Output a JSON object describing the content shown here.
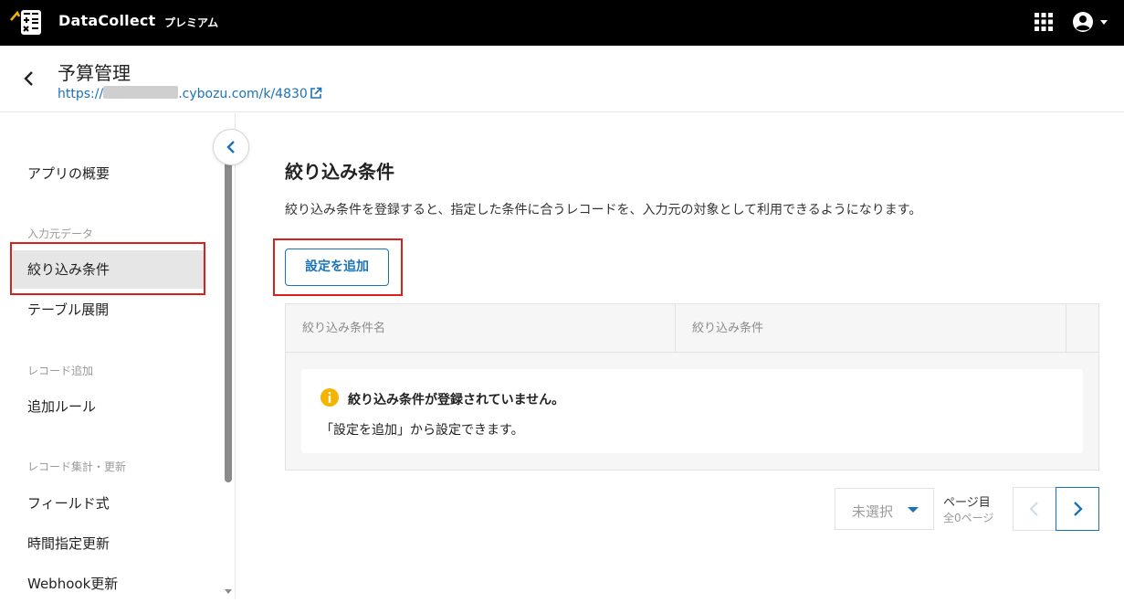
{
  "topbar": {
    "brand": "DataCollect",
    "plan": "プレミアム",
    "icons": [
      "datacollect-logo-icon",
      "apps-grid-icon",
      "account-icon",
      "caret-down-icon"
    ]
  },
  "app": {
    "title": "予算管理",
    "url_prefix": "https://",
    "url_suffix": ".cybozu.com/k/4830"
  },
  "sidebar": {
    "items": [
      {
        "label": "アプリの概要"
      },
      {
        "section": "入力元データ"
      },
      {
        "label": "絞り込み条件",
        "active": true
      },
      {
        "label": "テーブル展開"
      },
      {
        "section": "レコード追加"
      },
      {
        "label": "追加ルール"
      },
      {
        "section": "レコード集計・更新"
      },
      {
        "label": "フィールド式"
      },
      {
        "label": "時間指定更新"
      },
      {
        "label": "Webhook更新"
      }
    ]
  },
  "main": {
    "title": "絞り込み条件",
    "description": "絞り込み条件を登録すると、指定した条件に合うレコードを、入力元の対象として利用できるようになります。",
    "add_button": "設定を追加",
    "table": {
      "columns": [
        "絞り込み条件名",
        "絞り込み条件"
      ],
      "empty_title": "絞り込み条件が登録されていません。",
      "empty_desc": "「設定を追加」から設定できます。"
    },
    "pagination": {
      "select_value": "未選択",
      "page_label": "ページ目",
      "total": "全0ページ"
    }
  },
  "colors": {
    "accent": "#1a73b9",
    "highlight": "#d9211c",
    "warning": "#f4b400",
    "topbar": "#000000"
  }
}
